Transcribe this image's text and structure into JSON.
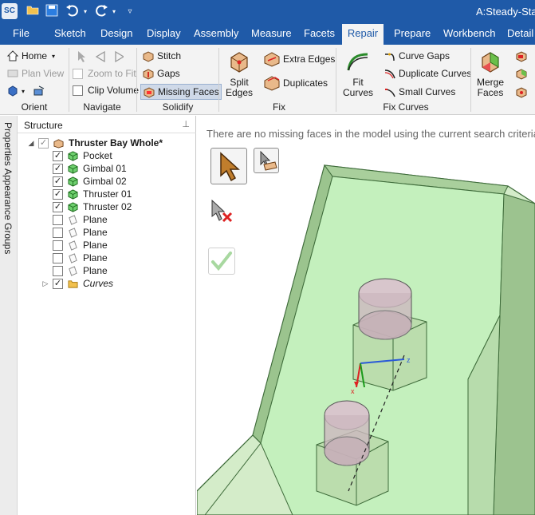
{
  "titlebar": {
    "app_logo": "SC",
    "document_title": "A:Steady-State"
  },
  "ribbon_tabs": [
    "File",
    "Sketch",
    "Design",
    "Display",
    "Assembly",
    "Measure",
    "Facets",
    "Repair",
    "Prepare",
    "Workbench",
    "Detail"
  ],
  "active_tab": "Repair",
  "ribbon": {
    "orient": {
      "label": "Orient",
      "home": "Home",
      "plan_view": "Plan View"
    },
    "navigate": {
      "label": "Navigate",
      "zoom_to_fit": "Zoom to Fit",
      "clip_volume": "Clip Volume"
    },
    "solidify": {
      "label": "Solidify",
      "stitch": "Stitch",
      "gaps": "Gaps",
      "missing_faces": "Missing Faces"
    },
    "fix": {
      "label": "Fix",
      "split_edges": "Split\nEdges",
      "extra_edges": "Extra Edges",
      "duplicates": "Duplicates"
    },
    "fix_curves": {
      "label": "Fix Curves",
      "fit_curves": "Fit\nCurves",
      "curve_gaps": "Curve Gaps",
      "duplicate_curves": "Duplicate Curves",
      "small_curves": "Small Curves"
    },
    "merge": {
      "merge_faces": "Merge\nFaces"
    }
  },
  "side_tabs": [
    "Properties",
    "Appearance",
    "Groups"
  ],
  "structure": {
    "title": "Structure",
    "root": "Thruster Bay Whole*",
    "items": [
      {
        "label": "Pocket",
        "checked": true,
        "kind": "solid"
      },
      {
        "label": "Gimbal 01",
        "checked": true,
        "kind": "solid"
      },
      {
        "label": "Gimbal 02",
        "checked": true,
        "kind": "solid"
      },
      {
        "label": "Thruster 01",
        "checked": true,
        "kind": "solid"
      },
      {
        "label": "Thruster 02",
        "checked": true,
        "kind": "solid"
      },
      {
        "label": "Plane",
        "checked": false,
        "kind": "plane"
      },
      {
        "label": "Plane",
        "checked": false,
        "kind": "plane"
      },
      {
        "label": "Plane",
        "checked": false,
        "kind": "plane"
      },
      {
        "label": "Plane",
        "checked": false,
        "kind": "plane"
      },
      {
        "label": "Plane",
        "checked": false,
        "kind": "plane"
      },
      {
        "label": "Curves",
        "checked": true,
        "kind": "folder"
      }
    ]
  },
  "viewport": {
    "message": "There are no missing faces in the model using the current search criteria"
  },
  "colors": {
    "title_bar": "#1f5aa8",
    "model_green": "#c9e8c0",
    "model_edge": "#3e6b3a"
  }
}
